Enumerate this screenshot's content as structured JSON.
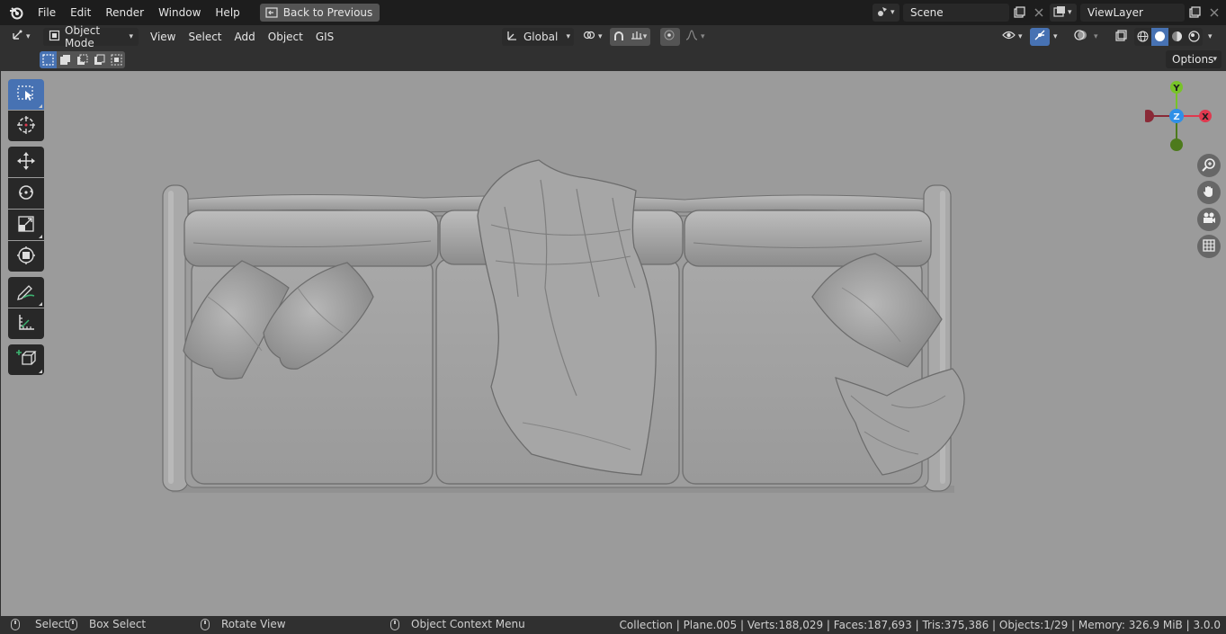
{
  "menu": {
    "items": [
      "File",
      "Edit",
      "Render",
      "Window",
      "Help"
    ],
    "back_button": "Back to Previous"
  },
  "scene": {
    "label": "Scene"
  },
  "viewlayer": {
    "label": "ViewLayer"
  },
  "header": {
    "mode": "Object Mode",
    "menus": [
      "View",
      "Select",
      "Add",
      "Object",
      "GIS"
    ],
    "orientation": "Global"
  },
  "toolsettings": {
    "options_label": "Options"
  },
  "gizmo": {
    "y": "Y",
    "z": "Z",
    "x": "X"
  },
  "statusbar": {
    "select": "Select",
    "box_select": "Box Select",
    "rotate_view": "Rotate View",
    "context_menu": "Object Context Menu",
    "stats": "Collection | Plane.005 | Verts:188,029 | Faces:187,693 | Tris:375,386 | Objects:1/29 | Memory: 326.9 MiB | 3.0.0"
  },
  "colors": {
    "accent": "#4772b3",
    "viewport_bg": "#9b9b9b",
    "axis_x": "#e0394f",
    "axis_y": "#78c329",
    "axis_z": "#2f8fe7"
  }
}
